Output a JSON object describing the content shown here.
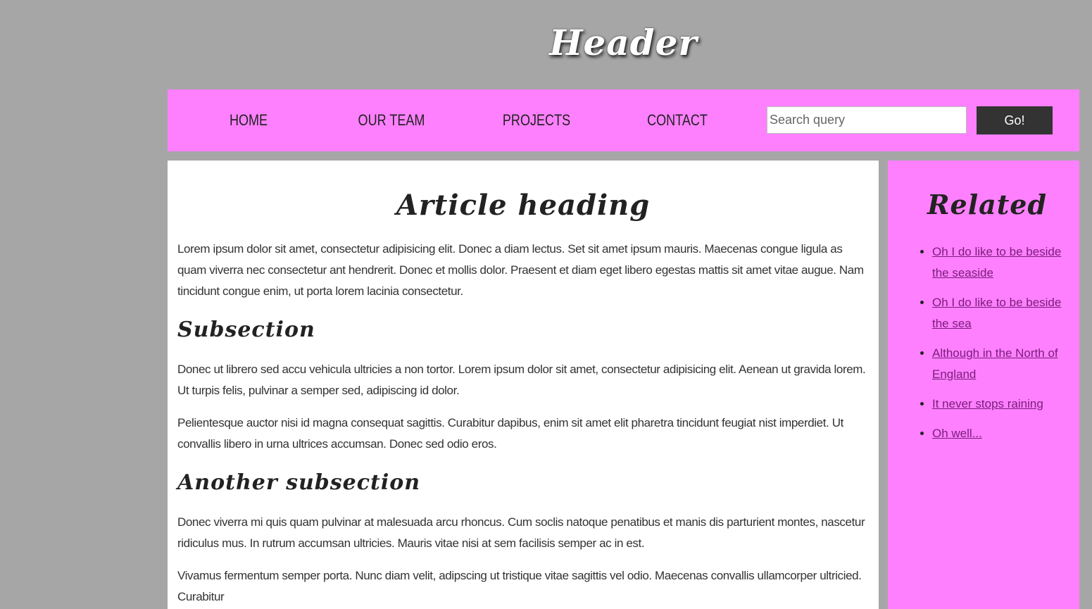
{
  "header": {
    "title": "Header"
  },
  "nav": {
    "items": [
      {
        "label": "HOME"
      },
      {
        "label": "OUR TEAM"
      },
      {
        "label": "PROJECTS"
      },
      {
        "label": "CONTACT"
      }
    ],
    "search": {
      "placeholder": "Search query",
      "value": ""
    },
    "go_label": "Go!"
  },
  "article": {
    "heading": "Article heading",
    "intro": "Lorem ipsum dolor sit amet, consectetur adipisicing elit. Donec a diam lectus. Set sit amet ipsum mauris. Maecenas congue ligula as quam viverra nec consectetur ant hendrerit. Donec et mollis dolor. Praesent et diam eget libero egestas mattis sit amet vitae augue. Nam tincidunt congue enim, ut porta lorem lacinia consectetur.",
    "subsection_heading": "Subsection",
    "subsection_paragraphs": [
      "Donec ut librero sed accu vehicula ultricies a non tortor. Lorem ipsum dolor sit amet, consectetur adipisicing elit. Aenean ut gravida lorem. Ut turpis felis, pulvinar a semper sed, adipiscing id dolor.",
      "Pelientesque auctor nisi id magna consequat sagittis. Curabitur dapibus, enim sit amet elit pharetra tincidunt feugiat nist imperdiet. Ut convallis libero in urna ultrices accumsan. Donec sed odio eros."
    ],
    "another_heading": "Another subsection",
    "another_paragraphs": [
      "Donec viverra mi quis quam pulvinar at malesuada arcu rhoncus. Cum soclis natoque penatibus et manis dis parturient montes, nascetur ridiculus mus. In rutrum accumsan ultricies. Mauris vitae nisi at sem facilisis semper ac in est.",
      "Vivamus fermentum semper porta. Nunc diam velit, adipscing ut tristique vitae sagittis vel odio. Maecenas convallis ullamcorper ultricied. Curabitur"
    ]
  },
  "sidebar": {
    "heading": "Related",
    "links": [
      {
        "label": "Oh I do like to be beside the seaside"
      },
      {
        "label": "Oh I do like to be beside the sea"
      },
      {
        "label": "Although in the North of England"
      },
      {
        "label": "It never stops raining"
      },
      {
        "label": "Oh well..."
      }
    ]
  },
  "colors": {
    "page_background": "#a6a6a6",
    "accent_pink": "#ff80ff",
    "button_dark": "#333333",
    "content_background": "#ffffff"
  }
}
